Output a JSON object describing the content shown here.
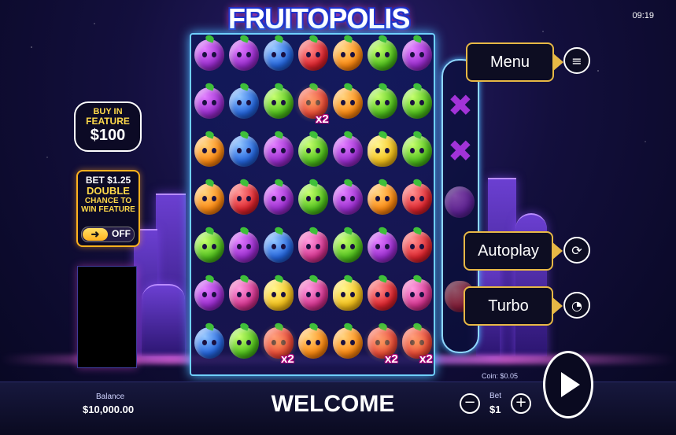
{
  "game": {
    "title": "FRUITOPOLIS",
    "clock": "09:19"
  },
  "grid": {
    "rows": [
      [
        "purple",
        "purple",
        "blue",
        "red",
        "orange",
        "green",
        "purple"
      ],
      [
        "purple",
        "blue",
        "green",
        "red",
        "orange",
        "green",
        "green"
      ],
      [
        "orange",
        "blue",
        "purple",
        "green",
        "purple",
        "pine",
        "green"
      ],
      [
        "orange",
        "red",
        "purple",
        "green",
        "purple",
        "orange",
        "red"
      ],
      [
        "green",
        "purple",
        "blue",
        "grape",
        "green",
        "purple",
        "red"
      ],
      [
        "purple",
        "grape",
        "pine",
        "grape",
        "pine",
        "red",
        "grape"
      ],
      [
        "blue",
        "green",
        "red",
        "orange",
        "orange",
        "red",
        "red"
      ]
    ],
    "multipliers": [
      {
        "row": 1,
        "col": 3,
        "label": "x2"
      },
      {
        "row": 6,
        "col": 2,
        "label": "x2"
      },
      {
        "row": 6,
        "col": 5,
        "label": "x2"
      },
      {
        "row": 6,
        "col": 6,
        "label": "x2"
      }
    ]
  },
  "side_column": {
    "marks": [
      "close-x-icon",
      "close-x-icon"
    ]
  },
  "menu": {
    "label": "Menu",
    "icon": "hamburger-icon"
  },
  "autoplay": {
    "label": "Autoplay",
    "icon": "autoplay-icon"
  },
  "turbo": {
    "label": "Turbo",
    "icon": "speedometer-icon"
  },
  "buy_feature": {
    "line1": "BUY IN",
    "line2": "FEATURE",
    "price": "$100"
  },
  "double_chance": {
    "bet": "BET $1.25",
    "title": "DOUBLE",
    "line1": "CHANCE TO",
    "line2": "WIN FEATURE",
    "toggle_state": "OFF",
    "toggle_icon": "arrow-right-icon"
  },
  "footer": {
    "balance_label": "Balance",
    "balance_value": "$10,000.00",
    "message": "WELCOME",
    "coin_label": "Coin: $0.05",
    "bet_label": "Bet",
    "bet_value": "$1",
    "minus": "−",
    "plus": "+"
  }
}
